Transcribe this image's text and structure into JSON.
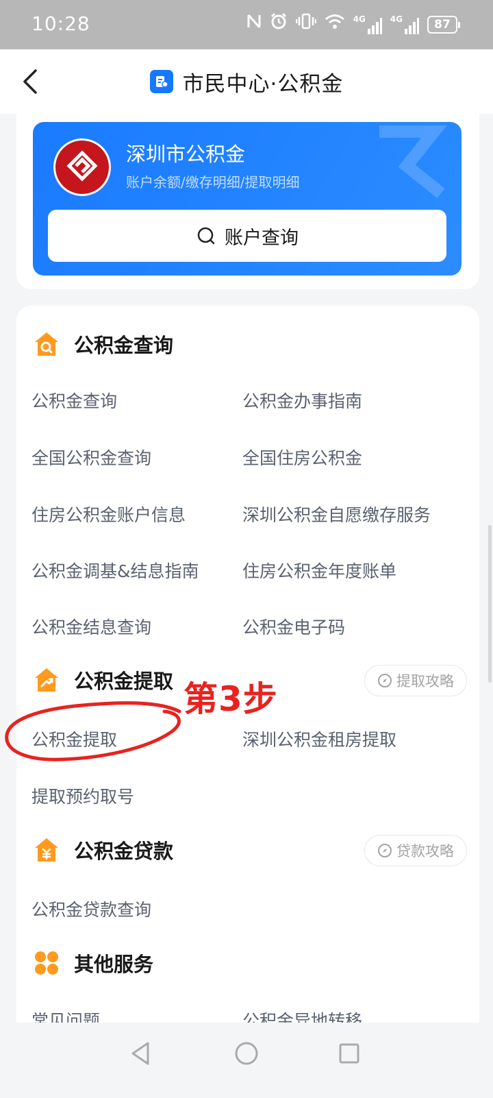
{
  "status_bar": {
    "time": "10:28",
    "battery": "87",
    "signal1": "4G",
    "signal2": "4G"
  },
  "nav": {
    "title": "市民中心·公积金"
  },
  "hf_card": {
    "title": "深圳市公积金",
    "subtitle": "账户余额/缴存明细/提取明细",
    "query_label": "账户查询"
  },
  "sections": {
    "query": {
      "title": "公积金查询",
      "items": [
        "公积金查询",
        "公积金办事指南",
        "全国公积金查询",
        "全国住房公积金",
        "住房公积金账户信息",
        "深圳公积金自愿缴存服务",
        "公积金调基&结息指南",
        "住房公积金年度账单",
        "公积金结息查询",
        "公积金电子码"
      ]
    },
    "withdraw": {
      "title": "公积金提取",
      "guide": "提取攻略",
      "items": [
        "公积金提取",
        "深圳公积金租房提取",
        "提取预约取号"
      ]
    },
    "loan": {
      "title": "公积金贷款",
      "guide": "贷款攻略",
      "items": [
        "公积金贷款查询"
      ]
    },
    "other": {
      "title": "其他服务",
      "items": [
        "常见问题",
        "公积金异地转移"
      ]
    }
  },
  "annotation": {
    "text": "第3步",
    "color": "#e8231f"
  },
  "colors": {
    "brand_blue": "#1677ff",
    "section_orange": "#ff9a1f",
    "logo_red": "#c4161c"
  },
  "icons": [
    "back-icon",
    "app-logo-icon",
    "housing-fund-logo-icon",
    "search-icon",
    "house-search-icon",
    "house-withdraw-icon",
    "house-loan-icon",
    "grid-icon",
    "compass-icon"
  ]
}
